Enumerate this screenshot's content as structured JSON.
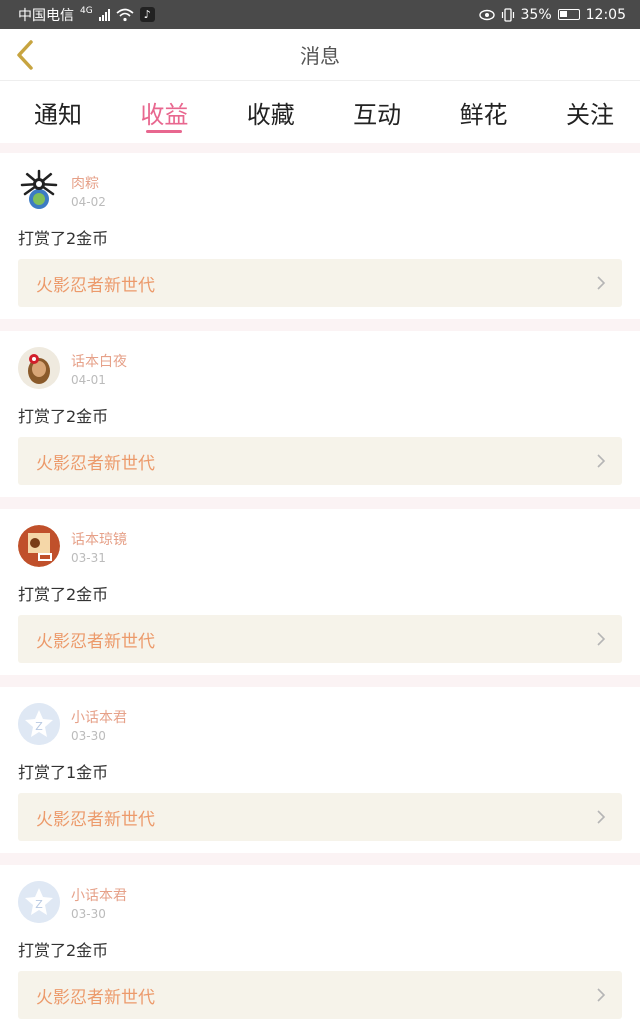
{
  "status_bar": {
    "carrier": "中国电信",
    "signal_type": "4G",
    "battery": "35%",
    "time": "12:05"
  },
  "header": {
    "title": "消息",
    "back_icon": "chevron-left-icon"
  },
  "tabs": [
    {
      "label": "通知",
      "active": false
    },
    {
      "label": "收益",
      "active": true
    },
    {
      "label": "收藏",
      "active": false
    },
    {
      "label": "互动",
      "active": false
    },
    {
      "label": "鲜花",
      "active": false
    },
    {
      "label": "关注",
      "active": false
    }
  ],
  "messages": [
    {
      "username": "肉粽",
      "date": "04-02",
      "text": "打赏了2金币",
      "link_title": "火影忍者新世代"
    },
    {
      "username": "话本白夜",
      "date": "04-01",
      "text": "打赏了2金币",
      "link_title": "火影忍者新世代"
    },
    {
      "username": "话本琼镜",
      "date": "03-31",
      "text": "打赏了2金币",
      "link_title": "火影忍者新世代"
    },
    {
      "username": "小话本君",
      "date": "03-30",
      "text": "打赏了1金币",
      "link_title": "火影忍者新世代"
    },
    {
      "username": "小话本君",
      "date": "03-30",
      "text": "打赏了2金币",
      "link_title": "火影忍者新世代"
    }
  ],
  "colors": {
    "accent": "#e8678f",
    "username": "#e6a189",
    "link_text": "#ec9a6b",
    "link_bg": "#f6f3ea",
    "feed_bg": "#fbf3f4"
  }
}
